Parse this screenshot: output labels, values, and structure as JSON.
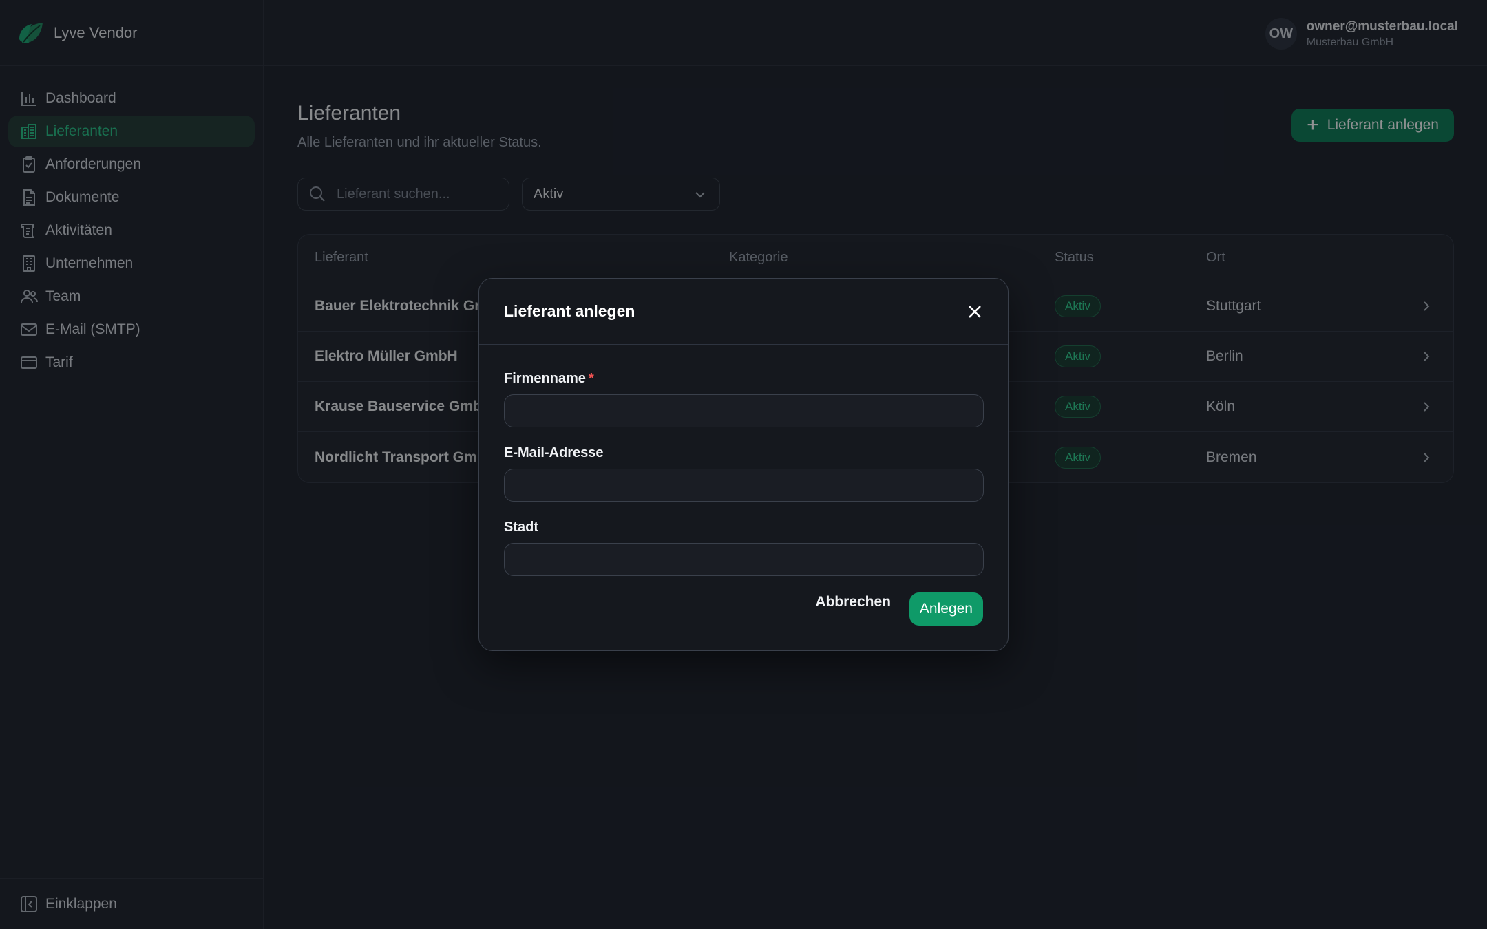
{
  "app": {
    "name": "Lyve Vendor"
  },
  "colors": {
    "accent": "#0f9a68",
    "active_nav": "#27c387",
    "danger": "#f05252"
  },
  "user": {
    "initials": "OW",
    "email": "owner@musterbau.local",
    "company": "Musterbau GmbH"
  },
  "sidebar": {
    "items": [
      {
        "label": "Dashboard",
        "icon": "bar-chart-icon"
      },
      {
        "label": "Lieferanten",
        "icon": "building-icon",
        "active": true
      },
      {
        "label": "Anforderungen",
        "icon": "clipboard-check-icon"
      },
      {
        "label": "Dokumente",
        "icon": "document-icon"
      },
      {
        "label": "Aktivitäten",
        "icon": "scroll-icon"
      },
      {
        "label": "Unternehmen",
        "icon": "office-icon"
      },
      {
        "label": "Team",
        "icon": "users-icon"
      },
      {
        "label": "E-Mail (SMTP)",
        "icon": "mail-icon"
      },
      {
        "label": "Tarif",
        "icon": "credit-card-icon"
      }
    ],
    "collapse_label": "Einklappen"
  },
  "main": {
    "title": "Lieferanten",
    "subtitle": "Alle Lieferanten und ihr aktueller Status.",
    "add_button": "Lieferant anlegen",
    "search_placeholder": "Lieferant suchen...",
    "filter_value": "Aktiv"
  },
  "table": {
    "columns": [
      "Lieferant",
      "Kategorie",
      "Status",
      "Ort"
    ],
    "rows": [
      {
        "name": "Bauer Elektrotechnik GmbH",
        "status": "Aktiv",
        "city": "Stuttgart"
      },
      {
        "name": "Elektro Müller GmbH",
        "status": "Aktiv",
        "city": "Berlin"
      },
      {
        "name": "Krause Bauservice GmbH",
        "status": "Aktiv",
        "city": "Köln"
      },
      {
        "name": "Nordlicht Transport GmbH",
        "status": "Aktiv",
        "city": "Bremen"
      }
    ]
  },
  "modal": {
    "title": "Lieferant anlegen",
    "fields": [
      {
        "label": "Firmenname",
        "required_mark": "*",
        "value": ""
      },
      {
        "label": "E-Mail-Adresse",
        "value": ""
      },
      {
        "label": "Stadt",
        "value": ""
      }
    ],
    "cancel": "Abbrechen",
    "submit": "Anlegen"
  }
}
